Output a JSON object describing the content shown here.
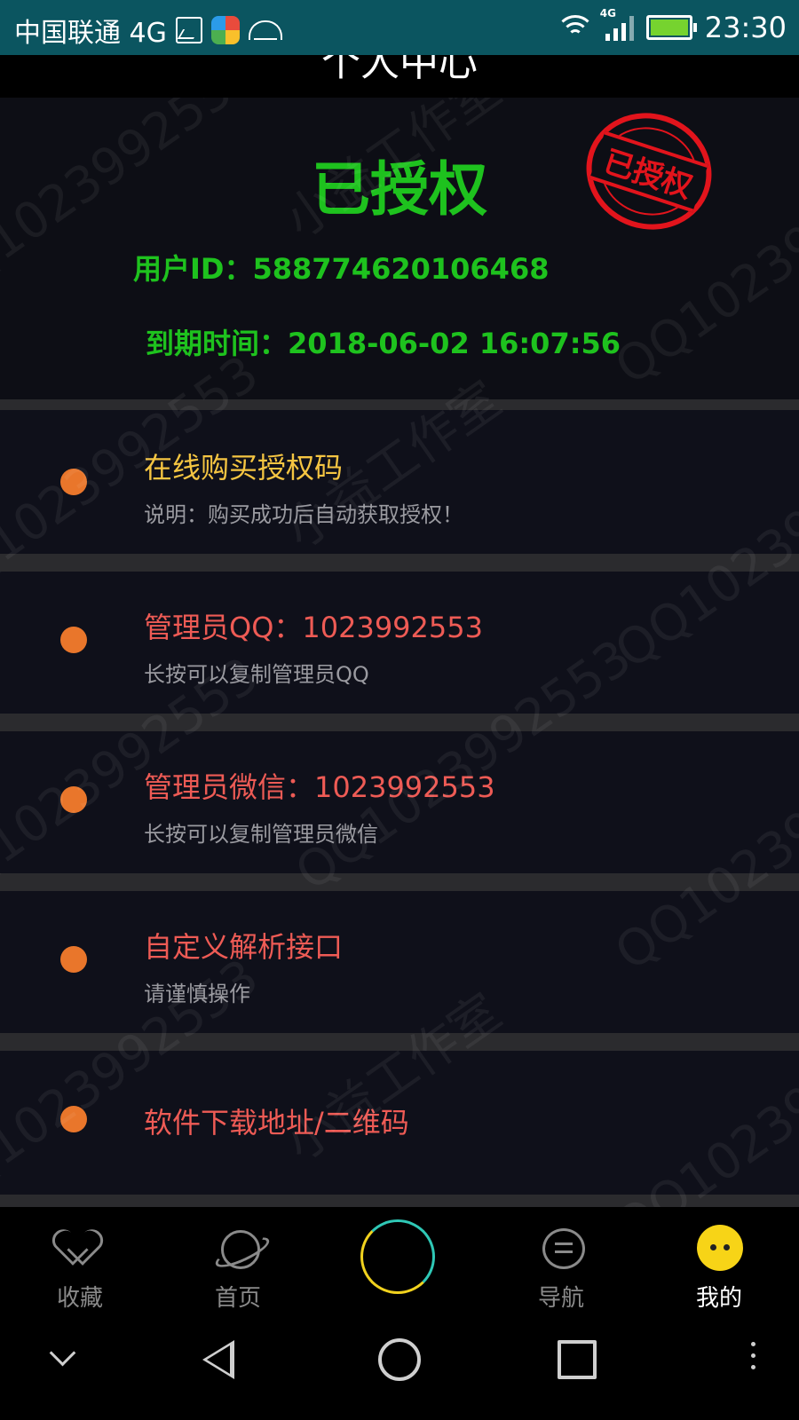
{
  "status_bar": {
    "carrier": "中国联通 4G",
    "network_badge": "4G",
    "time": "23:30",
    "icons": [
      "image-icon",
      "colorful-app-icon",
      "android-icon",
      "wifi-icon",
      "signal-icon",
      "battery-icon"
    ]
  },
  "page": {
    "title": "个人中心"
  },
  "header": {
    "status_text": "已授权",
    "stamp_text": "已授权",
    "user_id_label": "用户ID：",
    "user_id_value": "588774620106468",
    "expire_label": "到期时间：",
    "expire_value": "2018-06-02 16:07:56"
  },
  "menu": [
    {
      "title": "在线购买授权码",
      "subtitle": "说明：购买成功后自动获取授权！",
      "title_color": "#f5c542"
    },
    {
      "title": "管理员QQ：1023992553",
      "subtitle": "长按可以复制管理员QQ",
      "title_color": "#ee5b55"
    },
    {
      "title": "管理员微信：1023992553",
      "subtitle": "长按可以复制管理员微信",
      "title_color": "#ee5b55"
    },
    {
      "title": "自定义解析接口",
      "subtitle": "请谨慎操作",
      "title_color": "#ee5b55"
    },
    {
      "title": "软件下载地址/二维码",
      "subtitle": "",
      "title_color": "#ee5b55"
    }
  ],
  "watermark": {
    "text_a": "小益工作室",
    "text_b": "QQ1023992553"
  },
  "tabs": [
    {
      "label": "收藏",
      "icon": "heart-icon",
      "active": false
    },
    {
      "label": "首页",
      "icon": "planet-icon",
      "active": false
    },
    {
      "label": "",
      "icon": "center-ring-icon",
      "active": false
    },
    {
      "label": "导航",
      "icon": "chat-list-icon",
      "active": false
    },
    {
      "label": "我的",
      "icon": "face-icon",
      "active": true
    }
  ],
  "colors": {
    "accent_green": "#1ec21e",
    "stamp_red": "#e2141c",
    "dot_orange": "#e9762b",
    "item_yellow": "#f5c542",
    "item_red": "#ee5b55"
  }
}
